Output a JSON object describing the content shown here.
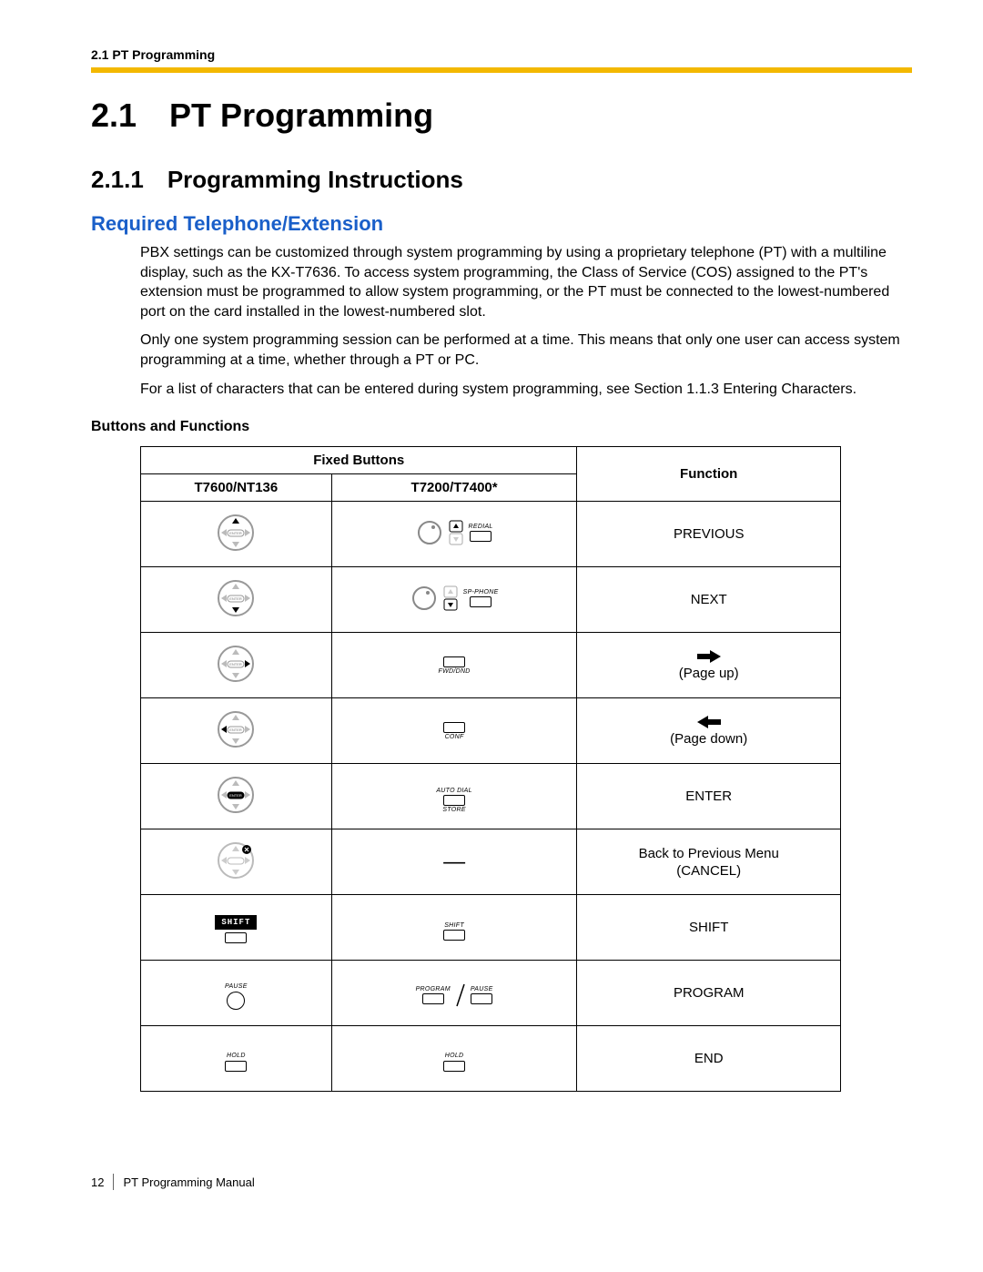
{
  "header": {
    "running": "2.1 PT Programming"
  },
  "h1": {
    "num": "2.1",
    "title": "PT Programming"
  },
  "h2": {
    "num": "2.1.1",
    "title": "Programming Instructions"
  },
  "h3": "Required Telephone/Extension",
  "para1": "PBX settings can be customized through system programming by using a proprietary telephone (PT) with a multiline display, such as the KX-T7636. To access system programming, the Class of Service (COS) assigned to the PT's extension must be programmed to allow system programming, or the PT must be connected to the lowest-numbered port on the card installed in the lowest-numbered slot.",
  "para2": "Only one system programming session can be performed at a time. This means that only one user can access system programming at a time, whether through a PT or PC.",
  "para3": "For a list of characters that can be entered during system programming, see Section 1.1.3 Entering Characters.",
  "h4": "Buttons and Functions",
  "table": {
    "hdr_fixed": "Fixed Buttons",
    "hdr_fn": "Function",
    "hdr_col1": "T7600/NT136",
    "hdr_col2": "T7200/T7400*",
    "rows": [
      {
        "col2_label": "REDIAL",
        "fn_top": "PREVIOUS",
        "fn_sub": ""
      },
      {
        "col2_label": "SP-PHONE",
        "fn_top": "NEXT",
        "fn_sub": ""
      },
      {
        "col2_label": "FWD/DND",
        "fn_top": "",
        "fn_sub": "(Page up)"
      },
      {
        "col2_label": "CONF",
        "fn_top": "",
        "fn_sub": "(Page down)"
      },
      {
        "col2_top": "AUTO DIAL",
        "col2_bot": "STORE",
        "fn_top": "ENTER",
        "fn_sub": ""
      },
      {
        "fn_top": "Back to Previous Menu",
        "fn_sub": "(CANCEL)"
      },
      {
        "col2_label": "SHIFT",
        "fn_top": "SHIFT",
        "fn_sub": ""
      },
      {
        "col1_label": "PAUSE",
        "col2_a": "PROGRAM",
        "col2_b": "PAUSE",
        "fn_top": "PROGRAM",
        "fn_sub": ""
      },
      {
        "col1_label": "HOLD",
        "col2_label": "HOLD",
        "fn_top": "END",
        "fn_sub": ""
      }
    ]
  },
  "icons": {
    "up_hl": "up",
    "down_hl": "down",
    "right_hl": "right",
    "left_hl": "left",
    "center_hl": "center",
    "cancel_hl": "cancel"
  },
  "footer": {
    "page": "12",
    "title": "PT Programming Manual"
  }
}
